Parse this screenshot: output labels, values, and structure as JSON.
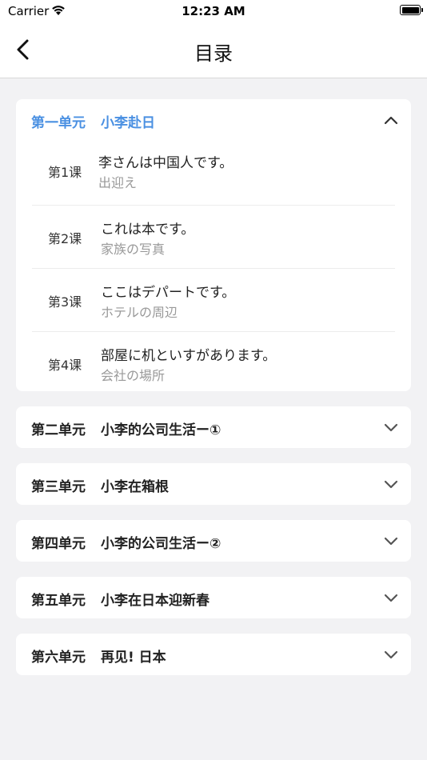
{
  "status_bar": {
    "carrier": "Carrier",
    "time": "12:23 AM"
  },
  "nav": {
    "title": "目录",
    "back_icon": "chevron-left-icon"
  },
  "colors": {
    "accent": "#4a90e2",
    "background": "#f2f2f4"
  },
  "units": [
    {
      "label": "第一单元",
      "title": "小李赴日",
      "expanded": true,
      "lessons": [
        {
          "num": "第1课",
          "title": "李さんは中国人です。",
          "sub": "出迎え"
        },
        {
          "num": "第2课",
          "title": "これは本です。",
          "sub": "家族の写真"
        },
        {
          "num": "第3课",
          "title": "ここはデパートです。",
          "sub": "ホテルの周辺"
        },
        {
          "num": "第4课",
          "title": "部屋に机といすがあります。",
          "sub": "会社の場所"
        }
      ]
    },
    {
      "label": "第二单元",
      "title": "小李的公司生活ー①",
      "expanded": false
    },
    {
      "label": "第三单元",
      "title": "小李在箱根",
      "expanded": false
    },
    {
      "label": "第四单元",
      "title": "小李的公司生活ー②",
      "expanded": false
    },
    {
      "label": "第五单元",
      "title": "小李在日本迎新春",
      "expanded": false
    },
    {
      "label": "第六单元",
      "title": "再见! 日本",
      "expanded": false
    }
  ]
}
